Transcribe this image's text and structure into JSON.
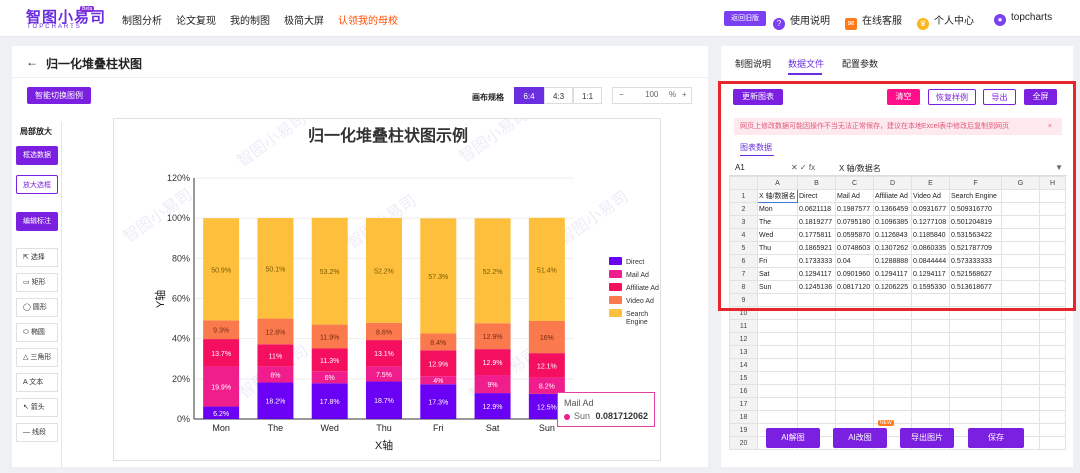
{
  "app": {
    "logo_cn": "智图小易司",
    "logo_en": "TOPCHARTS",
    "beta": "Beta"
  },
  "nav": {
    "items": [
      "制图分析",
      "论文复现",
      "我的制图",
      "极简大屏"
    ],
    "highlight": "认领我的母校",
    "old_version": "返回旧版",
    "help": "使用说明",
    "service": "在线客服",
    "personal": "个人中心",
    "user": "topcharts"
  },
  "editor": {
    "back": "←",
    "title": "归一化堆叠柱状图",
    "switch_btn": "智能切换图例",
    "canvas_label": "画布规格",
    "ratios": [
      "6:4",
      "4:3",
      "1:1"
    ],
    "zoom_minus": "−",
    "zoom_value": "100",
    "zoom_unit": "%",
    "zoom_plus": "+"
  },
  "sidebar": {
    "title": "局部放大",
    "select_data": "框选数据",
    "zoom_box": "放大选框",
    "edit_label": "编辑标注",
    "tools": [
      "选择",
      "矩形",
      "圆形",
      "椭圆",
      "三角形",
      "文本",
      "箭头",
      "线段"
    ]
  },
  "chart_data": {
    "type": "bar",
    "stacked": true,
    "normalized": true,
    "title": "归一化堆叠柱状图示例",
    "xlabel": "X轴",
    "ylabel": "Y轴",
    "ylim": [
      0,
      1.2
    ],
    "yticks": [
      "0%",
      "20%",
      "40%",
      "60%",
      "80%",
      "100%",
      "120%"
    ],
    "categories": [
      "Mon",
      "The",
      "Wed",
      "Thu",
      "Fri",
      "Sat",
      "Sun"
    ],
    "series": [
      {
        "name": "Direct",
        "color": "#6a00f4",
        "values": [
          0.062,
          0.182,
          0.178,
          0.187,
          0.173,
          0.129,
          0.125
        ],
        "labels": [
          "6.2%",
          "18.2%",
          "17.8%",
          "18.7%",
          "17.3%",
          "12.9%",
          "12.5%"
        ]
      },
      {
        "name": "Mail Ad",
        "color": "#f01e8c",
        "values": [
          0.199,
          0.08,
          0.06,
          0.075,
          0.04,
          0.09,
          0.082
        ],
        "labels": [
          "19.9%",
          "8%",
          "6%",
          "7.5%",
          "4%",
          "9%",
          "8.2%"
        ]
      },
      {
        "name": "Affiliate Ad",
        "color": "#f5105f",
        "values": [
          0.137,
          0.11,
          0.113,
          0.131,
          0.129,
          0.129,
          0.121
        ],
        "labels": [
          "13.7%",
          "11%",
          "11.3%",
          "13.1%",
          "12.9%",
          "12.9%",
          "12.1%"
        ]
      },
      {
        "name": "Video Ad",
        "color": "#fa7a4e",
        "values": [
          0.093,
          0.128,
          0.119,
          0.086,
          0.084,
          0.129,
          0.16
        ],
        "labels": [
          "9.3%",
          "12.8%",
          "11.9%",
          "8.6%",
          "8.4%",
          "12.9%",
          "16%"
        ]
      },
      {
        "name": "Search Engine",
        "color": "#fdbf3c",
        "values": [
          0.509,
          0.501,
          0.532,
          0.522,
          0.573,
          0.522,
          0.514
        ],
        "labels": [
          "50.9%",
          "50.1%",
          "53.2%",
          "52.2%",
          "57.3%",
          "52.2%",
          "51.4%"
        ]
      }
    ],
    "legend": "right",
    "tooltip": {
      "series": "Mail Ad",
      "category": "Sun",
      "value": "0.081712062"
    },
    "watermark": "智图小易司"
  },
  "right": {
    "tabs": [
      "制图说明",
      "数据文件",
      "配置参数"
    ],
    "update_btn": "更新图表",
    "clear_btn": "清空",
    "restore_btn": "恢复样例",
    "export_btn": "导出",
    "fullscreen_btn": "全屏",
    "warning": "网页上修改数据可能因操作不当无法正常保存，建议在本地Excel表中修改后复制到网页",
    "warning_close": "×",
    "sub_tab": "图表数据",
    "cell_ref": "A1",
    "formula_icons": "✕  ✓  fx",
    "formula_value": "X 轴/数据名",
    "col_headers": [
      "A",
      "B",
      "C",
      "D",
      "E",
      "F",
      "G",
      "H"
    ],
    "header_row": [
      "X 轴/数据名",
      "Direct",
      "Mail Ad",
      "Affiliate Ad",
      "Video Ad",
      "Search Engine",
      "",
      ""
    ],
    "rows": [
      [
        "Mon",
        "0.0621118",
        "0.1987577",
        "0.1366459",
        "0.0931677",
        "0.509316770",
        "",
        ""
      ],
      [
        "The",
        "0.1819277",
        "0.0795180",
        "0.1096385",
        "0.1277108",
        "0.501204819",
        "",
        ""
      ],
      [
        "Wed",
        "0.1775811",
        "0.0595870",
        "0.1126843",
        "0.1185840",
        "0.531563422",
        "",
        ""
      ],
      [
        "Thu",
        "0.1865921",
        "0.0748603",
        "0.1307262",
        "0.0860335",
        "0.521787709",
        "",
        ""
      ],
      [
        "Fri",
        "0.1733333",
        "0.04",
        "0.1288888",
        "0.0844444",
        "0.573333333",
        "",
        ""
      ],
      [
        "Sat",
        "0.1294117",
        "0.0901960",
        "0.1294117",
        "0.1294117",
        "0.521568627",
        "",
        ""
      ],
      [
        "Sun",
        "0.1245136",
        "0.0817120",
        "0.1206225",
        "0.1595330",
        "0.513618677",
        "",
        ""
      ]
    ],
    "empty_row_numbers": [
      "9",
      "10",
      "11",
      "12",
      "13",
      "14",
      "15",
      "16",
      "17",
      "18",
      "19",
      "20"
    ],
    "bottom_buttons": [
      "AI解图",
      "AI改图",
      "导出图片",
      "保存"
    ],
    "badge": "NEW"
  }
}
